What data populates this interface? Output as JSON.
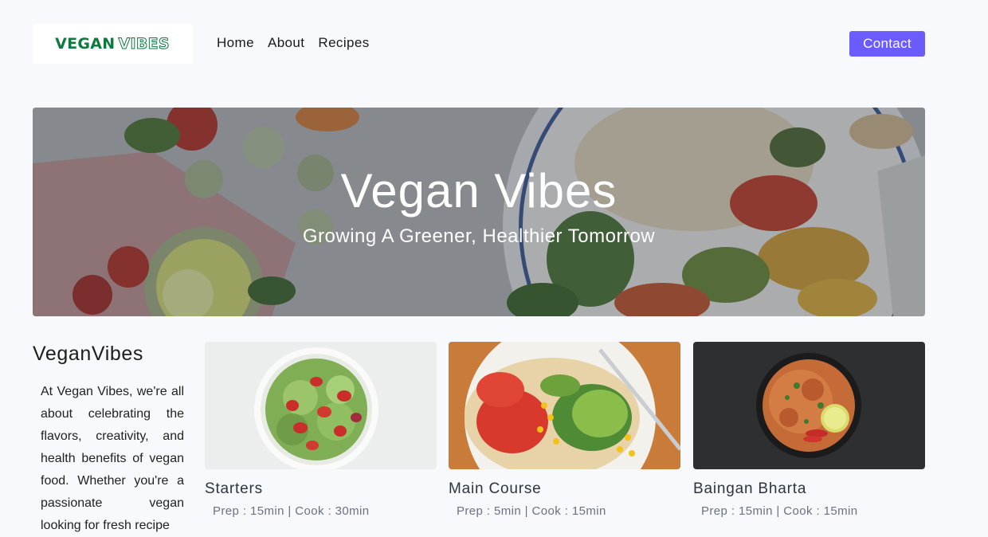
{
  "header": {
    "logo_solid": "VEGAN",
    "logo_outline": "VIBES",
    "nav": [
      "Home",
      "About",
      "Recipes"
    ],
    "contact_label": "Contact"
  },
  "hero": {
    "title": "Vegan Vibes",
    "subtitle": "Growing A Greener, Healthier Tomorrow"
  },
  "about": {
    "heading": "VeganVibes",
    "text": "At Vegan Vibes, we're all about celebrating the flavors, creativity, and health benefits of vegan food. Whether you're a passionate vegan looking for fresh recipe"
  },
  "cards": [
    {
      "title": "Starters",
      "meta": "Prep : 15min | Cook : 30min"
    },
    {
      "title": "Main Course",
      "meta": "Prep : 5min | Cook : 15min"
    },
    {
      "title": "Baingan Bharta",
      "meta": "Prep : 15min | Cook : 15min"
    }
  ],
  "colors": {
    "accent": "#6a5cff",
    "logo_green": "#0d7a3e",
    "page_bg": "#f7f9fc"
  }
}
